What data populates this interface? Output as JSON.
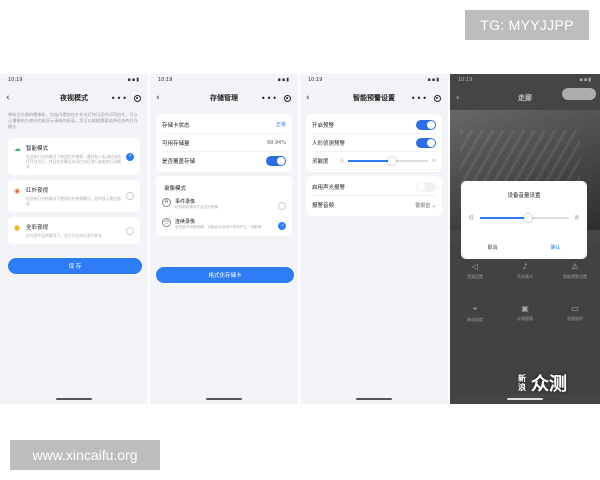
{
  "badges": {
    "telegram": "TG: MYYJJPP",
    "site": "www.xincaifu.org"
  },
  "watermark": {
    "line1": "新",
    "line2": "浪",
    "main": "众测"
  },
  "screen1": {
    "time": "10:19",
    "title": "夜视模式",
    "description": "带有全光源的摄像机，包括内置的红外补光灯和可见的LED白光，可以让摄像机在夜间也能显示清晰的画面。您可以根据需要选择适合的灯光模式",
    "modes": [
      {
        "icon": "cloud-icon",
        "title": "智能模式",
        "desc": "在没有灯光的情况下使用红外夜视，遇到有人走动时自动打开白光灯，并且在安静后关闭白光灯进行省电的灯光模式",
        "selected": true
      },
      {
        "icon": "infrared-icon",
        "title": "红外夜视",
        "desc": "在没有灯光的情况下使用红外夜视模式，此时显示黑白画面",
        "selected": false
      },
      {
        "icon": "bulb-icon",
        "title": "全彩夜视",
        "desc": "在光线不足的情况下，会打开白光灯进行补光",
        "selected": false
      }
    ],
    "save_label": "保 存",
    "accent": "#2e7df6"
  },
  "screen2": {
    "time": "10:19",
    "title": "存储管理",
    "rows": [
      {
        "label": "存储卡状态",
        "value": "正常"
      },
      {
        "label": "可用存储量",
        "value": "99.94%"
      },
      {
        "label": "是否覆盖存储",
        "value": ""
      }
    ],
    "section": "录像模式",
    "rec_modes": [
      {
        "icon": "event-icon",
        "title": "事件录像",
        "desc": "检测到异常时才会进行录像",
        "selected": false
      },
      {
        "icon": "clock-icon",
        "title": "连续录像",
        "desc": "全天候不间断录像，可能会对存储卡寿命产生一定影响",
        "selected": true
      }
    ],
    "format_label": "格式化存储卡"
  },
  "screen3": {
    "time": "10:19",
    "title": "智能预警设置",
    "rows": [
      {
        "label": "开启预警"
      },
      {
        "label": "人形侦测预警"
      }
    ],
    "sensitivity": {
      "label": "灵敏度",
      "low": "低",
      "high": "中",
      "level": 0.55
    },
    "sound_alarm": "启用声光报警",
    "alarm_sound": {
      "label": "报警音频",
      "value": "警报音"
    }
  },
  "screen4": {
    "time": "10:19",
    "title": "走廊",
    "modal": {
      "title": "设备音量设置",
      "low": "低",
      "high": "高",
      "level": 0.55,
      "cancel": "取消",
      "ok": "确认"
    },
    "grid": [
      {
        "icon": "speaker-icon",
        "label": "音量设置"
      },
      {
        "icon": "sound-icon",
        "label": "声光模式"
      },
      {
        "icon": "alert-icon",
        "label": "智能预警设置"
      },
      {
        "icon": "scan-icon",
        "label": "移动追踪"
      },
      {
        "icon": "storage-icon",
        "label": "存储管理"
      },
      {
        "icon": "screen-icon",
        "label": "画面旋转"
      }
    ]
  }
}
